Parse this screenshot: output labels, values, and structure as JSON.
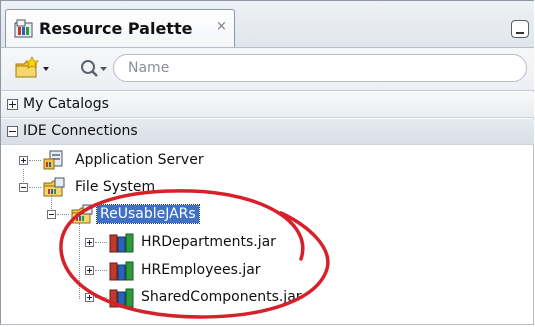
{
  "panel": {
    "tab_title": "Resource Palette",
    "tab_close": "×",
    "tab_icon": "resource-palette-icon",
    "minimize_icon": "minimize-icon"
  },
  "toolbar": {
    "new_icon": "new-catalog-icon",
    "search_icon": "search-icon",
    "search_placeholder": "Name",
    "search_value": ""
  },
  "sections": [
    {
      "label": "My Catalogs",
      "expanded": false
    },
    {
      "label": "IDE Connections",
      "expanded": true
    }
  ],
  "tree": {
    "application_server": {
      "label": "Application Server",
      "expanded": false,
      "icon": "application-server-icon"
    },
    "file_system": {
      "label": "File System",
      "expanded": true,
      "icon": "file-system-icon"
    },
    "reusable": {
      "label": "ReUsableJARs",
      "expanded": true,
      "selected": true,
      "icon": "folder-connection-icon"
    },
    "jars": [
      {
        "label": "HRDepartments.jar",
        "icon": "jar-icon"
      },
      {
        "label": "HREmployees.jar",
        "icon": "jar-icon"
      },
      {
        "label": "SharedComponents.jar",
        "icon": "jar-icon"
      }
    ]
  },
  "colors": {
    "selection": "#3f72c7",
    "annotation": "#d8202a"
  }
}
